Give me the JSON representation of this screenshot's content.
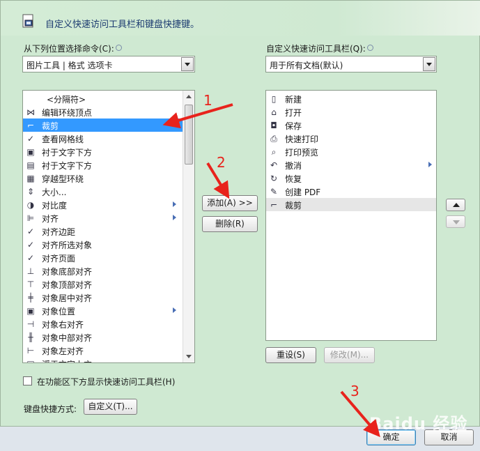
{
  "header": {
    "title": "自定义快速访问工具栏和键盘快捷键。"
  },
  "left": {
    "label": "从下列位置选择命令(C):",
    "combo_value": "图片工具 | 格式 选项卡",
    "items": [
      {
        "label": "<分隔符>",
        "icon": ""
      },
      {
        "label": "编辑环绕顶点",
        "icon": "⋈"
      },
      {
        "label": "裁剪",
        "icon": "⌐"
      },
      {
        "label": "查看网格线",
        "icon": "✓"
      },
      {
        "label": "衬于文字下方",
        "icon": "▣"
      },
      {
        "label": "衬于文字下方",
        "icon": "▤"
      },
      {
        "label": "穿越型环绕",
        "icon": "▦"
      },
      {
        "label": "大小...",
        "icon": "⇕"
      },
      {
        "label": "对比度",
        "icon": "◑"
      },
      {
        "label": "对齐",
        "icon": "⊫"
      },
      {
        "label": "对齐边距",
        "icon": "✓"
      },
      {
        "label": "对齐所选对象",
        "icon": "✓"
      },
      {
        "label": "对齐页面",
        "icon": "✓"
      },
      {
        "label": "对象底部对齐",
        "icon": "⊥"
      },
      {
        "label": "对象顶部对齐",
        "icon": "⊤"
      },
      {
        "label": "对象居中对齐",
        "icon": "╪"
      },
      {
        "label": "对象位置",
        "icon": "▣"
      },
      {
        "label": "对象右对齐",
        "icon": "⊣"
      },
      {
        "label": "对象中部对齐",
        "icon": "╫"
      },
      {
        "label": "对象左对齐",
        "icon": "⊢"
      },
      {
        "label": "浮于文字上方",
        "icon": "▣"
      }
    ]
  },
  "right": {
    "label": "自定义快速访问工具栏(Q):",
    "combo_value": "用于所有文档(默认)",
    "items": [
      {
        "label": "新建",
        "icon": "▯"
      },
      {
        "label": "打开",
        "icon": "⌂"
      },
      {
        "label": "保存",
        "icon": "◘"
      },
      {
        "label": "快速打印",
        "icon": "⎙"
      },
      {
        "label": "打印预览",
        "icon": "⌕"
      },
      {
        "label": "撤消",
        "icon": "↶"
      },
      {
        "label": "恢复",
        "icon": "↻"
      },
      {
        "label": "创建 PDF",
        "icon": "✎"
      },
      {
        "label": "裁剪",
        "icon": "⌐"
      }
    ]
  },
  "buttons": {
    "add": "添加(A) >>",
    "remove": "删除(R)",
    "reset": "重设(S)",
    "modify": "修改(M)...",
    "customize": "自定义(T)...",
    "ok": "确定",
    "cancel": "取消"
  },
  "checkbox_label": "在功能区下方显示快速访问工具栏(H)",
  "shortcut_label": "键盘快捷方式:",
  "annotations": [
    "1",
    "2",
    "3"
  ],
  "watermark": "Baidu 经验",
  "colors": {
    "selection": "#3399ff",
    "annotation": "#e8231c",
    "pane": "#cfe9d2"
  }
}
